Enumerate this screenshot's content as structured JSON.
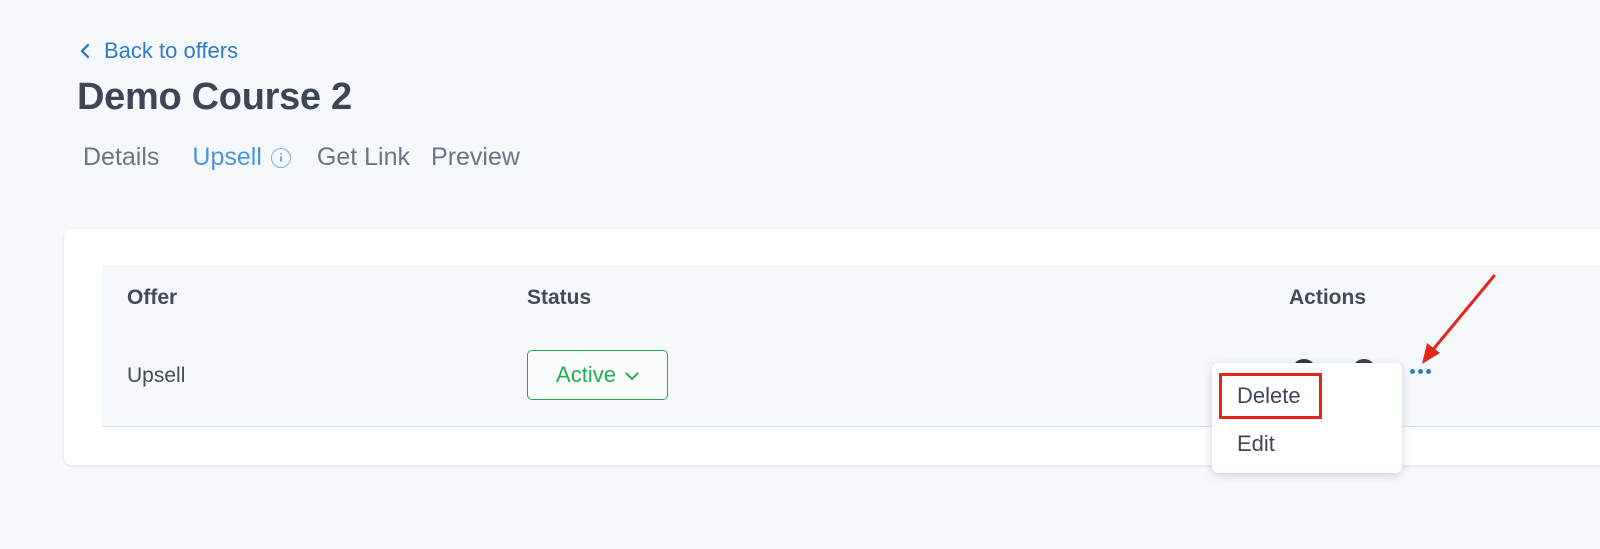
{
  "nav": {
    "back_label": "Back to offers"
  },
  "page": {
    "title": "Demo Course 2"
  },
  "tabs": [
    {
      "label": "Details",
      "active": false
    },
    {
      "label": "Upsell",
      "active": true,
      "icon": "info-icon"
    },
    {
      "label": "Get Link",
      "active": false
    },
    {
      "label": "Preview",
      "active": false
    }
  ],
  "table": {
    "headers": [
      "Offer",
      "Status",
      "Actions"
    ],
    "rows": [
      {
        "offer": "Upsell",
        "status": "Active",
        "actions": [
          "view-icon",
          "copy-icon",
          "more-options-icon"
        ]
      }
    ]
  },
  "dropdown_menu": {
    "items": [
      "Delete",
      "Edit"
    ],
    "highlighted": "Delete"
  },
  "annotation": {
    "color": "#e3261c"
  },
  "colors": {
    "background": "#f6f9fc",
    "link": "#2f7cc4",
    "active_tab": "#4a97dc",
    "status_active": "#1fae52"
  }
}
